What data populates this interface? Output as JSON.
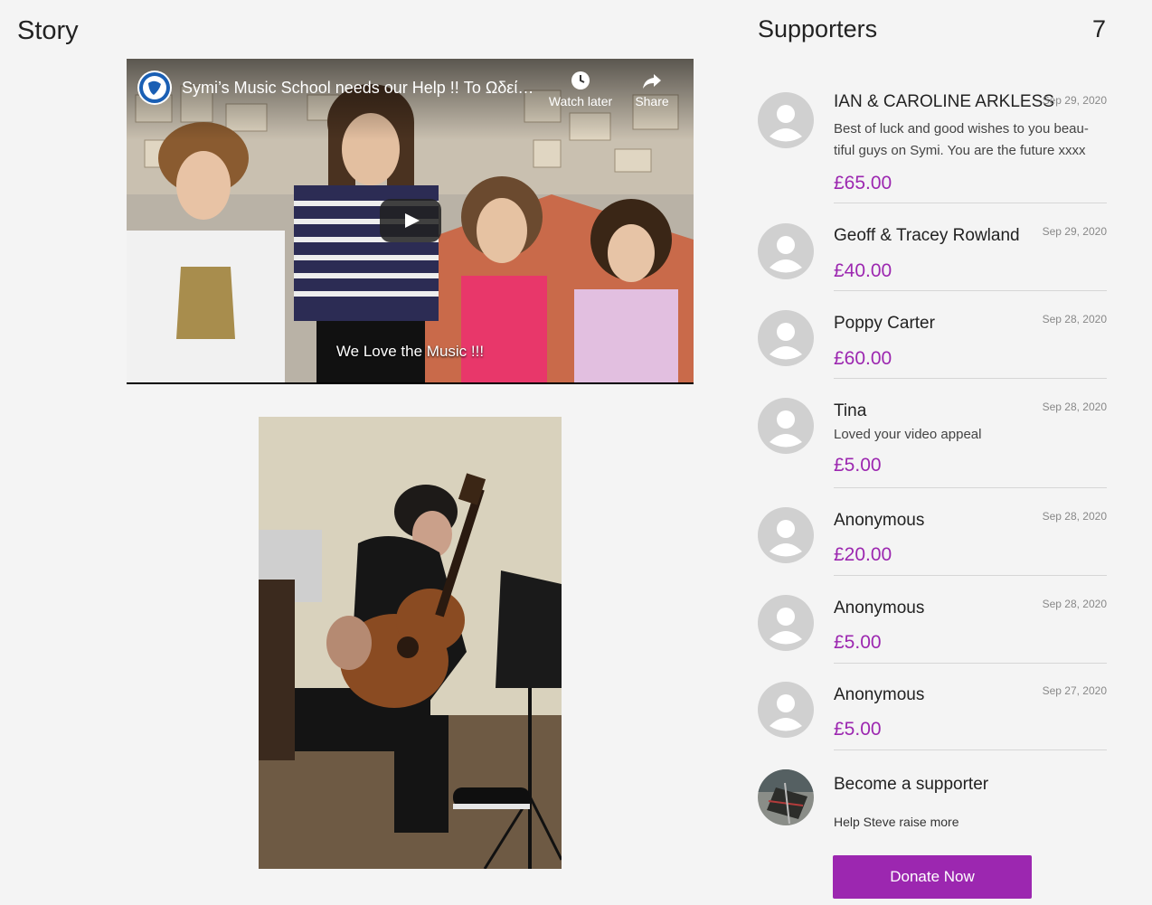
{
  "story": {
    "title": "Story",
    "video": {
      "title": "Symi’s Music School needs our Help !! Το Ωδείο...",
      "watch_later_label": "Watch later",
      "share_label": "Share",
      "caption": "We Love the Music !!!"
    }
  },
  "supporters": {
    "title": "Supporters",
    "count": "7",
    "items": [
      {
        "name": "IAN & CAROLINE ARKLESS",
        "date": "Sep 29, 2020",
        "message": "Best of luck and good wishes to you beau-tiful guys on Symi. You are the future xxxx",
        "amount": "£65.00"
      },
      {
        "name": "Geoff & Tracey Rowland",
        "date": "Sep 29, 2020",
        "message": "",
        "amount": "£40.00"
      },
      {
        "name": "Poppy Carter",
        "date": "Sep 28, 2020",
        "message": "",
        "amount": "£60.00"
      },
      {
        "name": "Tina",
        "date": "Sep 28, 2020",
        "message": "Loved your video appeal",
        "amount": "£5.00"
      },
      {
        "name": "Anonymous",
        "date": "Sep 28, 2020",
        "message": "",
        "amount": "£20.00"
      },
      {
        "name": "Anonymous",
        "date": "Sep 28, 2020",
        "message": "",
        "amount": "£5.00"
      },
      {
        "name": "Anonymous",
        "date": "Sep 27, 2020",
        "message": "",
        "amount": "£5.00"
      }
    ],
    "become": {
      "title": "Become a supporter",
      "subtitle": "Help Steve raise more",
      "button_label": "Donate Now"
    }
  },
  "colors": {
    "accent": "#9c27b0",
    "background": "#f4f4f4"
  }
}
